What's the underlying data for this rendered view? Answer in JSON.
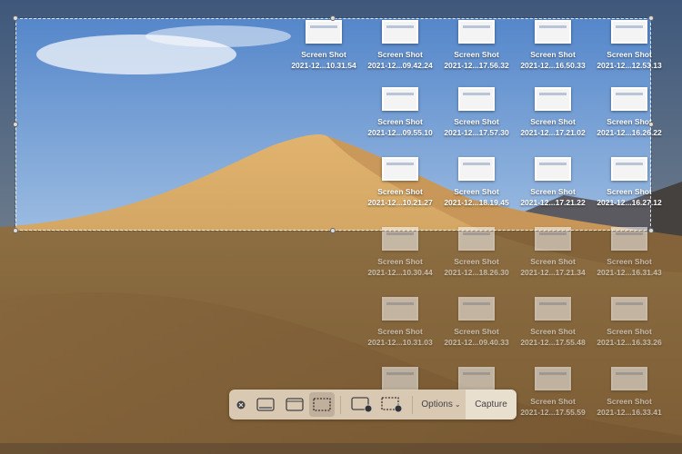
{
  "desktop": {
    "file_label": "Screen Shot",
    "rows": [
      [
        "2021-12...10.31.54",
        "2021-12...09.42.24",
        "2021-12...17.56.32",
        "2021-12...16.50.33",
        "2021-12...12.53.13"
      ],
      [
        null,
        "2021-12...09.55.10",
        "2021-12...17.57.30",
        "2021-12...17.21.02",
        "2021-12...16.26.22"
      ],
      [
        null,
        "2021-12...10.21.27",
        "2021-12...18.19.45",
        "2021-12...17.21.22",
        "2021-12...16.27.12"
      ],
      [
        null,
        "2021-12...10.30.44",
        "2021-12...18.26.30",
        "2021-12...17.21.34",
        "2021-12...16.31.43"
      ],
      [
        null,
        "2021-12...10.31.03",
        "2021-12...09.40.33",
        "2021-12...17.55.48",
        "2021-12...16.33.26"
      ],
      [
        null,
        "",
        "",
        "2021-12...17.55.59",
        "2021-12...16.33.41"
      ]
    ]
  },
  "toolbar": {
    "options_label": "Options",
    "capture_label": "Capture",
    "selected_mode": "capture-selected-portion"
  }
}
